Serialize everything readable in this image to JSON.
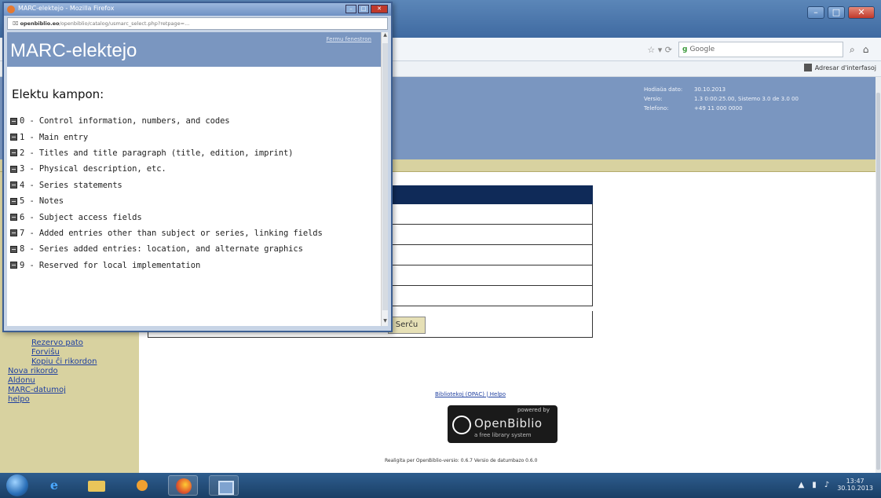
{
  "browser": {
    "search_engine": "Google",
    "bookmark_label": "Adresar d'interfasoj"
  },
  "page": {
    "header_info": [
      {
        "k": "Hodiaŭa dato:",
        "v": "30.10.2013"
      },
      {
        "k": "Versio:",
        "v": "1.3 0:00:25.00, Sistemo 3.0 de 3.0 00"
      },
      {
        "k": "Telefono:",
        "v": "+49 11 000 0000"
      }
    ],
    "sidebar_links": [
      "Rezervo pato",
      "Forviŝu",
      "Kopiu ĉi rikordon",
      "Nova rikordo",
      "Aldonu",
      "MARC-datumoj",
      "helpo"
    ],
    "search_button": "Serĉu",
    "footer_links": "Bibliotekoj (OPAC) | Helpo",
    "logo": {
      "powered_by": "powered by",
      "name": "OpenBiblio",
      "tagline": "a free library system"
    },
    "credits": "Realigita per OpenBiblio-versio: 0.6.7 Versio de datumbazo 0.6.0"
  },
  "popup": {
    "window_title": "MARC-elektejo - Mozilla Firefox",
    "url_host": "openbiblio.eo",
    "url_rest": "/openbiblio/catalog/usmarc_select.php?retpage=...",
    "heading": "MARC-elektejo",
    "close_link": "Fermu fenestron",
    "label": "Elektu kampon:",
    "fields": [
      "0 - Control information, numbers, and codes",
      "1 - Main entry",
      "2 - Titles and title paragraph (title, edition, imprint)",
      "3 - Physical description, etc.",
      "4 - Series statements",
      "5 - Notes",
      "6 - Subject access fields",
      "7 - Added entries other than subject or series, linking fields",
      "8 - Series added entries: location, and alternate graphics",
      "9 - Reserved for local implementation"
    ]
  },
  "taskbar": {
    "time": "13:47",
    "date": "30.10.2013"
  },
  "colors": {
    "header_blue": "#7a96c0",
    "sidebar_olive": "#d8d2a0",
    "form_head": "#0f2a58"
  }
}
